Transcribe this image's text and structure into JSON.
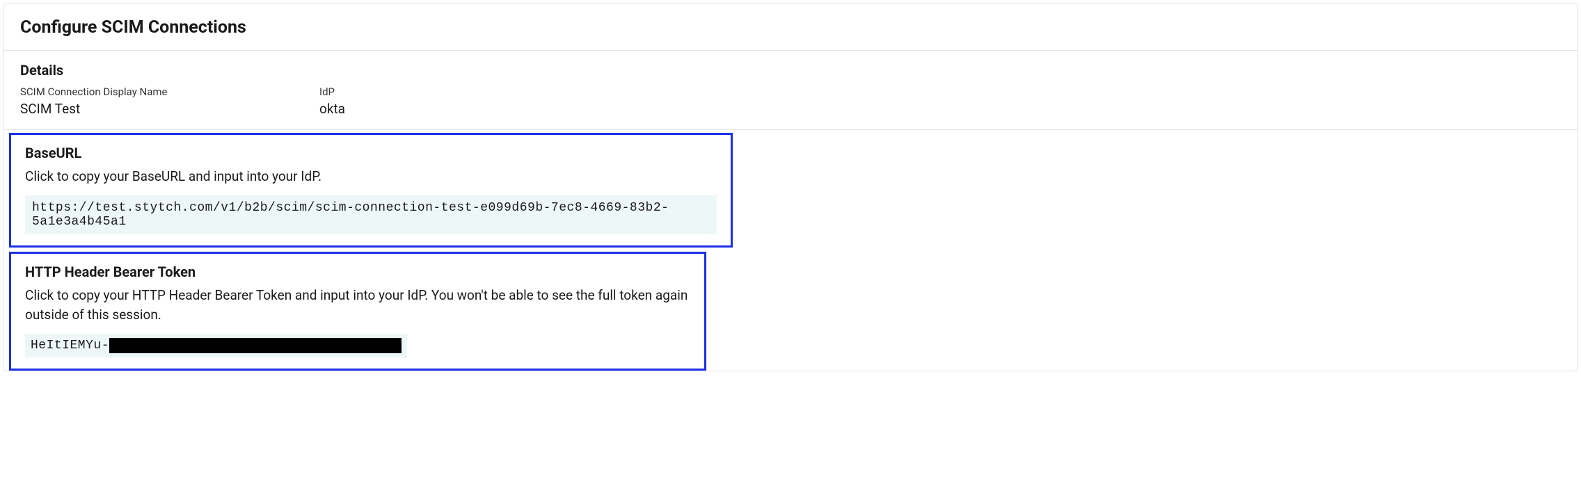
{
  "title": "Configure SCIM Connections",
  "details": {
    "heading": "Details",
    "fields": [
      {
        "label": "SCIM Connection Display Name",
        "value": "SCIM Test"
      },
      {
        "label": "IdP",
        "value": "okta"
      }
    ]
  },
  "baseurl": {
    "heading": "BaseURL",
    "description": "Click to copy your BaseURL and input into your IdP.",
    "value": "https://test.stytch.com/v1/b2b/scim/scim-connection-test-e099d69b-7ec8-4669-83b2-5a1e3a4b45a1"
  },
  "token": {
    "heading": "HTTP Header Bearer Token",
    "description": "Click to copy your HTTP Header Bearer Token and input into your IdP. You won't be able to see the full token again outside of this session.",
    "prefix": "HeItIEMYu-"
  }
}
